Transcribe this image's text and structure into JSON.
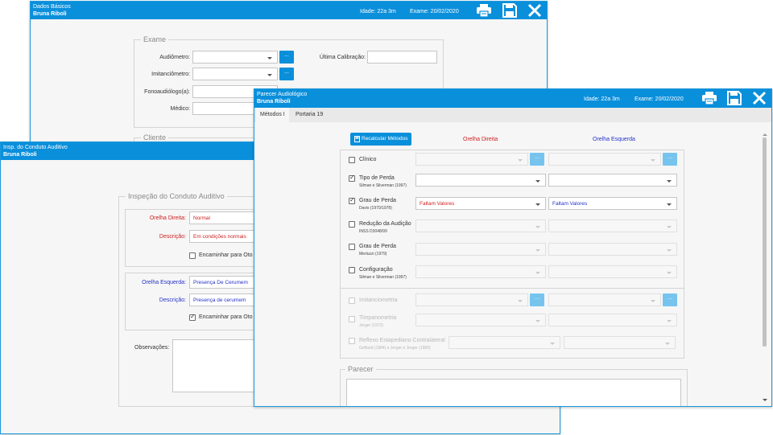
{
  "dados": {
    "title": "Dados Básicos",
    "patient": "Bruna Riboli",
    "idade": "Idade: 22a 3m",
    "exame": "Exame: 20/02/2020",
    "section_exame": "Exame",
    "section_cliente": "Cliente",
    "audiometro_label": "Audiômetro:",
    "imitanciometro_label": "Imitanciômetro:",
    "fono_label": "Fonoaudiólogo(a):",
    "medico_label": "Médico:",
    "calibracao_label": "Última Calibração:",
    "dots": "..."
  },
  "insp": {
    "title": "Insp. do Conduto Auditivo",
    "patient": "Bruna Riboli",
    "section": "Inspeção do Conduto Auditivo",
    "od_label": "Orelha Direita:",
    "od_value": "Normal",
    "od_desc_label": "Descrição:",
    "od_desc_value": "Em condições normais",
    "od_encaminhar": "Encaminhar para Oto",
    "oe_label": "Orelha Esquerda:",
    "oe_value": "Presença De Cerumem",
    "oe_desc_label": "Descrição:",
    "oe_desc_value": "Presença de cerumem",
    "oe_encaminhar": "Encaminhar para Oto",
    "obs_label": "Observações:",
    "check": "✓"
  },
  "parecer": {
    "title": "Parecer Audiológico",
    "patient": "Bruna Riboli",
    "idade": "Idade: 22a 3m",
    "exame": "Exame: 20/02/2020",
    "tabs": [
      "Métodos I",
      "Portaria 19"
    ],
    "recalc": "Recalcular Métodos",
    "col_od": "Orelha Direita",
    "col_oe": "Orelha Esquerda",
    "dots": "...",
    "check": "✓",
    "rows": [
      {
        "label": "Clínico",
        "sub": ""
      },
      {
        "label": "Tipo de Perda",
        "sub": "Silman e Silverman (1997)"
      },
      {
        "label": "Grau de Perda",
        "sub": "Davis (1970/1978)",
        "od": "Faltam Valores",
        "oe": "Faltam Valores"
      },
      {
        "label": "Redução da Audição",
        "sub": "INSS D3048/99"
      },
      {
        "label": "Grau de Perda",
        "sub": "Merluzzi (1979)"
      },
      {
        "label": "Configuração",
        "sub": "Silman e Silverman (1997)"
      },
      {
        "label": "Imitanciometria",
        "sub": ""
      },
      {
        "label": "Timpanometria",
        "sub": "Jerger (1972)"
      },
      {
        "label": "Reflexo Estapediano Contralateral",
        "sub": "Gelfand (1984) e Jerger e Jerger (1989)"
      }
    ],
    "section_parecer": "Parecer"
  },
  "colors": {
    "titlebar": "#0a8fdb",
    "od": "#cc1f1f",
    "oe": "#2532c9"
  }
}
